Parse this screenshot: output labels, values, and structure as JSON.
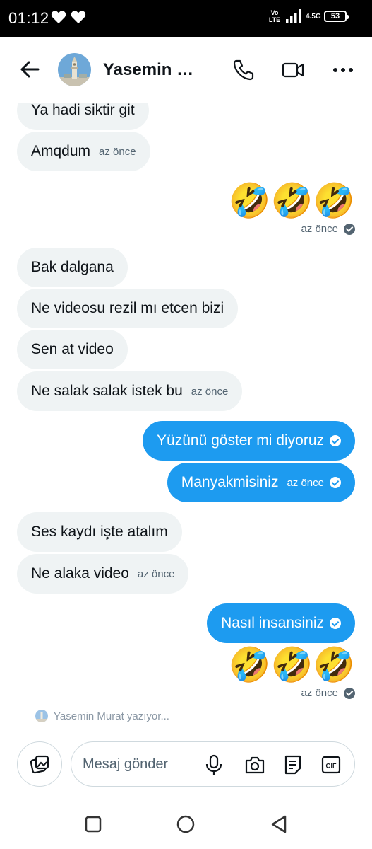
{
  "status_bar": {
    "time": "01:12",
    "volte": "Vo LTE",
    "network": "4.5G",
    "battery": "53"
  },
  "header": {
    "contact_name": "Yasemin Murat",
    "back_icon": "arrow-left-icon",
    "call_icon": "phone-icon",
    "video_icon": "video-camera-icon",
    "more_icon": "more-horizontal-icon"
  },
  "messages": [
    {
      "dir": "in",
      "text": "Ya hadi siktir git"
    },
    {
      "dir": "in",
      "text": "Amqdum",
      "time": "az önce"
    },
    {
      "dir": "out",
      "text": "🤣🤣🤣",
      "time": "az önce",
      "emoji": true
    },
    {
      "dir": "in",
      "text": "Bak dalgana"
    },
    {
      "dir": "in",
      "text": "Ne videosu rezil mı etcen bizi"
    },
    {
      "dir": "in",
      "text": "Sen at video"
    },
    {
      "dir": "in",
      "text": "Ne salak salak istek bu",
      "time": "az önce"
    },
    {
      "dir": "out",
      "text": "Yüzünü göster mi diyoruz"
    },
    {
      "dir": "out",
      "text": "Manyakmisiniz",
      "time": "az önce"
    },
    {
      "dir": "in",
      "text": "Ses kaydı işte atalım"
    },
    {
      "dir": "in",
      "text": "Ne alaka video",
      "time": "az önce"
    },
    {
      "dir": "out",
      "text": "Nasıl insansiniz"
    },
    {
      "dir": "out",
      "text": "🤣🤣🤣",
      "time": "az önce",
      "emoji": true
    }
  ],
  "typing_indicator": "Yasemin Murat yazıyor...",
  "composer": {
    "placeholder": "Mesaj gönder",
    "gif_label": "GIF",
    "icons": [
      "gallery-icon",
      "microphone-icon",
      "camera-icon",
      "note-icon",
      "gif-icon"
    ]
  },
  "colors": {
    "outgoing_bubble": "#1d9bf0",
    "incoming_bubble": "#eff3f4",
    "text": "#0f1419",
    "secondary_text": "#536471"
  }
}
